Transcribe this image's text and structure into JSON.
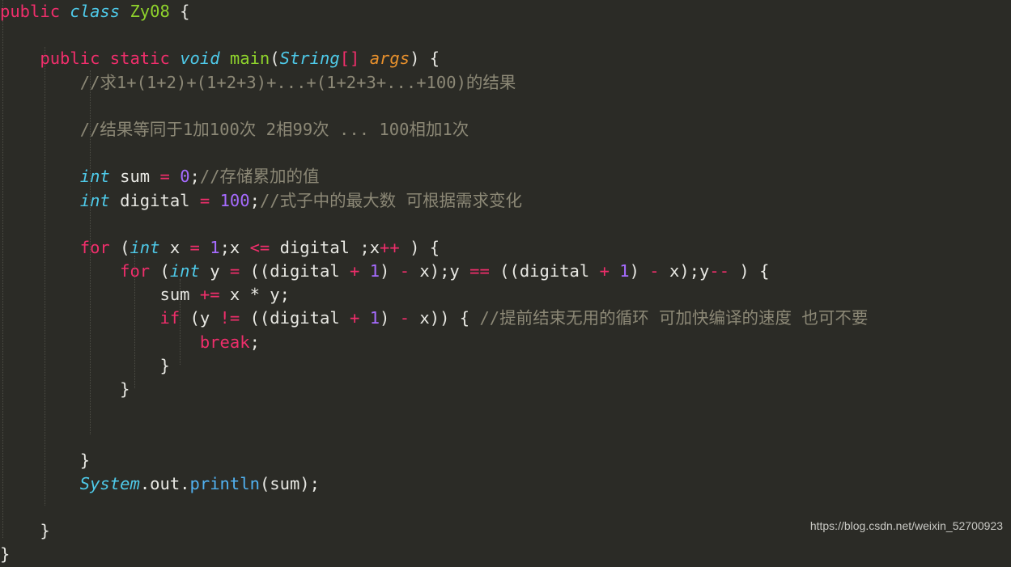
{
  "editor": {
    "background_color": "#2b2b26",
    "font_size_px": 20.5,
    "line_height_px": 29.2,
    "language": "Java",
    "indent_guide_color": "#4e4e46"
  },
  "palette": {
    "keyword": "#ef2e6b",
    "type": "#4ec9e8",
    "class_name": "#8fd32c",
    "function": "#8fd32c",
    "parameter": "#e8902c",
    "number": "#a66bff",
    "operator": "#ef2e6b",
    "plain_text": "#e8e8e3",
    "method_call": "#50b0ef",
    "comment": "#8c8876"
  },
  "watermark": {
    "text": "https://blog.csdn.net/weixin_52700923"
  },
  "code": {
    "line_01": {
      "t1": "public",
      "t2": " ",
      "t3": "class",
      "t4": " ",
      "t5": "Zy08",
      "t6": " {"
    },
    "line_02": {
      "text": ""
    },
    "line_03": {
      "indent": "    ",
      "t1": "public",
      "t2": " ",
      "t3": "static",
      "t4": " ",
      "t5": "void",
      "t6": " ",
      "t7": "main",
      "t8": "(",
      "t9": "String",
      "t10": "[]",
      "t11": " ",
      "t12": "args",
      "t13": ") {"
    },
    "line_04": {
      "indent": "        ",
      "comment": "//求1+(1+2)+(1+2+3)+...+(1+2+3+...+100)的结果"
    },
    "line_05": {
      "text": ""
    },
    "line_06": {
      "indent": "        ",
      "comment": "//结果等同于1加100次 2相99次 ... 100相加1次"
    },
    "line_07": {
      "text": ""
    },
    "line_08": {
      "indent": "        ",
      "t1": "int",
      "t2": " sum ",
      "t3": "=",
      "t4": " ",
      "t5": "0",
      "t6": ";",
      "t7": "//存储累加的值"
    },
    "line_09": {
      "indent": "        ",
      "t1": "int",
      "t2": " digital ",
      "t3": "=",
      "t4": " ",
      "t5": "100",
      "t6": ";",
      "t7": "//式子中的最大数 可根据需求变化"
    },
    "line_10": {
      "text": ""
    },
    "line_11": {
      "indent": "        ",
      "t1": "for",
      "t2": " (",
      "t3": "int",
      "t4": " x ",
      "t5": "=",
      "t6": " ",
      "t7": "1",
      "t8": ";x ",
      "t9": "<=",
      "t10": " digital ;x",
      "t11": "++",
      "t12": " ) {"
    },
    "line_12": {
      "indent": "            ",
      "t1": "for",
      "t2": " (",
      "t3": "int",
      "t4": " y ",
      "t5": "=",
      "t6": " ((digital ",
      "t7": "+",
      "t8": " ",
      "t9": "1",
      "t10": ") ",
      "t11": "-",
      "t12": " x);y ",
      "t13": "==",
      "t14": " ((digital ",
      "t15": "+",
      "t16": " ",
      "t17": "1",
      "t18": ") ",
      "t19": "-",
      "t20": " x);y",
      "t21": "--",
      "t22": " ) {"
    },
    "line_13": {
      "indent": "                ",
      "t1": "sum ",
      "t2": "+=",
      "t3": " x ",
      "t4": "*",
      "t5": " y;"
    },
    "line_14": {
      "indent": "                ",
      "t1": "if",
      "t2": " (y ",
      "t3": "!=",
      "t4": " ((digital ",
      "t5": "+",
      "t6": " ",
      "t7": "1",
      "t8": ") ",
      "t9": "-",
      "t10": " x)) { ",
      "t11": "//提前结束无用的循环 可加快编译的速度 也可不要"
    },
    "line_15": {
      "indent": "                    ",
      "t1": "break",
      "t2": ";"
    },
    "line_16": {
      "indent": "                ",
      "t1": "}"
    },
    "line_17": {
      "indent": "            ",
      "t1": "}"
    },
    "line_18": {
      "text": ""
    },
    "line_19": {
      "text": ""
    },
    "line_20": {
      "indent": "        ",
      "t1": "}"
    },
    "line_21": {
      "indent": "        ",
      "t1": "System",
      "t2": ".out.",
      "t3": "println",
      "t4": "(sum);"
    },
    "line_22": {
      "text": ""
    },
    "line_23": {
      "indent": "    ",
      "t1": "}"
    },
    "line_24": {
      "t1": "}"
    }
  }
}
